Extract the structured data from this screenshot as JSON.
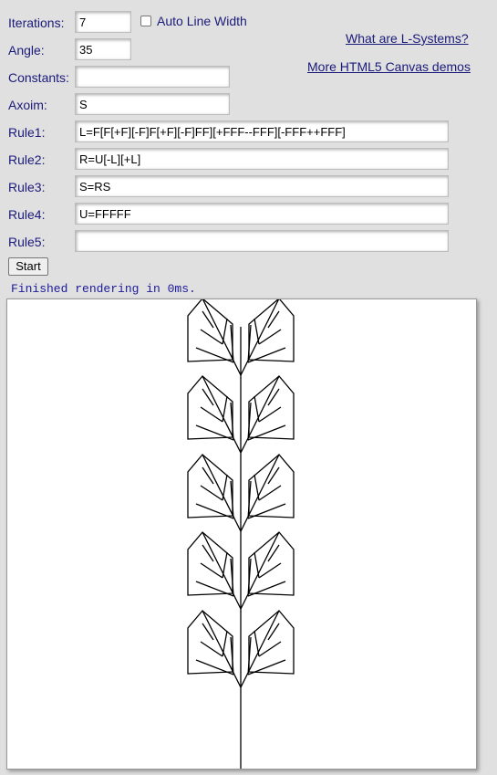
{
  "form": {
    "iterations": {
      "label": "Iterations:",
      "value": "7"
    },
    "auto_line_width": {
      "label": "Auto Line Width",
      "checked": false
    },
    "angle": {
      "label": "Angle:",
      "value": "35"
    },
    "constants": {
      "label": "Constants:",
      "value": ""
    },
    "axiom": {
      "label": "Axoim:",
      "value": "S"
    },
    "rule1": {
      "label": "Rule1:",
      "value": "L=F[F[+F][-F]F[+F][-F]FF][+FFF--FFF][-FFF++FFF]"
    },
    "rule2": {
      "label": "Rule2:",
      "value": "R=U[-L][+L]"
    },
    "rule3": {
      "label": "Rule3:",
      "value": "S=RS"
    },
    "rule4": {
      "label": "Rule4:",
      "value": "U=FFFFF"
    },
    "rule5": {
      "label": "Rule5:",
      "value": ""
    },
    "start_label": "Start"
  },
  "links": {
    "lsystems": "What are L-Systems?",
    "more_demos": "More HTML5 Canvas demos"
  },
  "status": "Finished rendering in 0ms.",
  "colors": {
    "background": "#e0e0e0",
    "label": "#1a1a7a",
    "status": "#1a1a9a",
    "stroke": "#000000"
  }
}
